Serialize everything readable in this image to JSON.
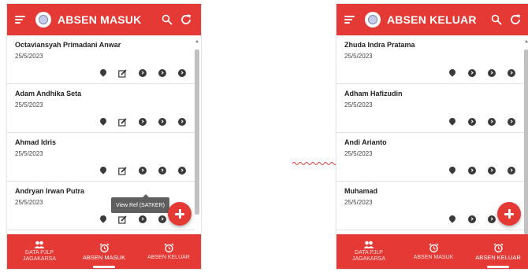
{
  "colors": {
    "primary": "#e53935",
    "icon": "#3a3a3a",
    "tooltip": "#5f5f5f"
  },
  "left_screen": {
    "title": "ABSEN MASUK",
    "items": [
      {
        "name": "Octaviansyah Primadani Anwar",
        "date": "25/5/2023"
      },
      {
        "name": "Adam Andhika Seta",
        "date": "25/5/2023"
      },
      {
        "name": "Ahmad Idris",
        "date": "25/5/2023"
      },
      {
        "name": "Andryan Irwan Putra",
        "date": "25/5/2023"
      }
    ],
    "tooltip": "View Ref (SATKER)",
    "bottom_nav": [
      {
        "label_line1": "DATA PJLP",
        "label_line2": "JAGAKARSA",
        "icon": "people-icon"
      },
      {
        "label_line1": "ABSEN MASUK",
        "label_line2": "",
        "icon": "alarm-icon",
        "active": true
      },
      {
        "label_line1": "ABSEN KELUAR",
        "label_line2": "",
        "icon": "alarm-icon"
      }
    ]
  },
  "right_screen": {
    "title": "ABSEN KELUAR",
    "items": [
      {
        "name": "Zhuda Indra Pratama",
        "date": "25/5/2023"
      },
      {
        "name": "Adham Hafizudin",
        "date": "25/5/2023"
      },
      {
        "name": "Andi Arianto",
        "date": "25/5/2023"
      },
      {
        "name": "Muhamad",
        "date": "25/5/2023"
      }
    ],
    "bottom_nav": [
      {
        "label_line1": "DATA PJLP",
        "label_line2": "JAGAKARSA",
        "icon": "people-icon"
      },
      {
        "label_line1": "ABSEN MASUK",
        "label_line2": "",
        "icon": "alarm-icon"
      },
      {
        "label_line1": "ABSEN KELUAR",
        "label_line2": "",
        "icon": "alarm-icon",
        "active": true
      }
    ]
  }
}
